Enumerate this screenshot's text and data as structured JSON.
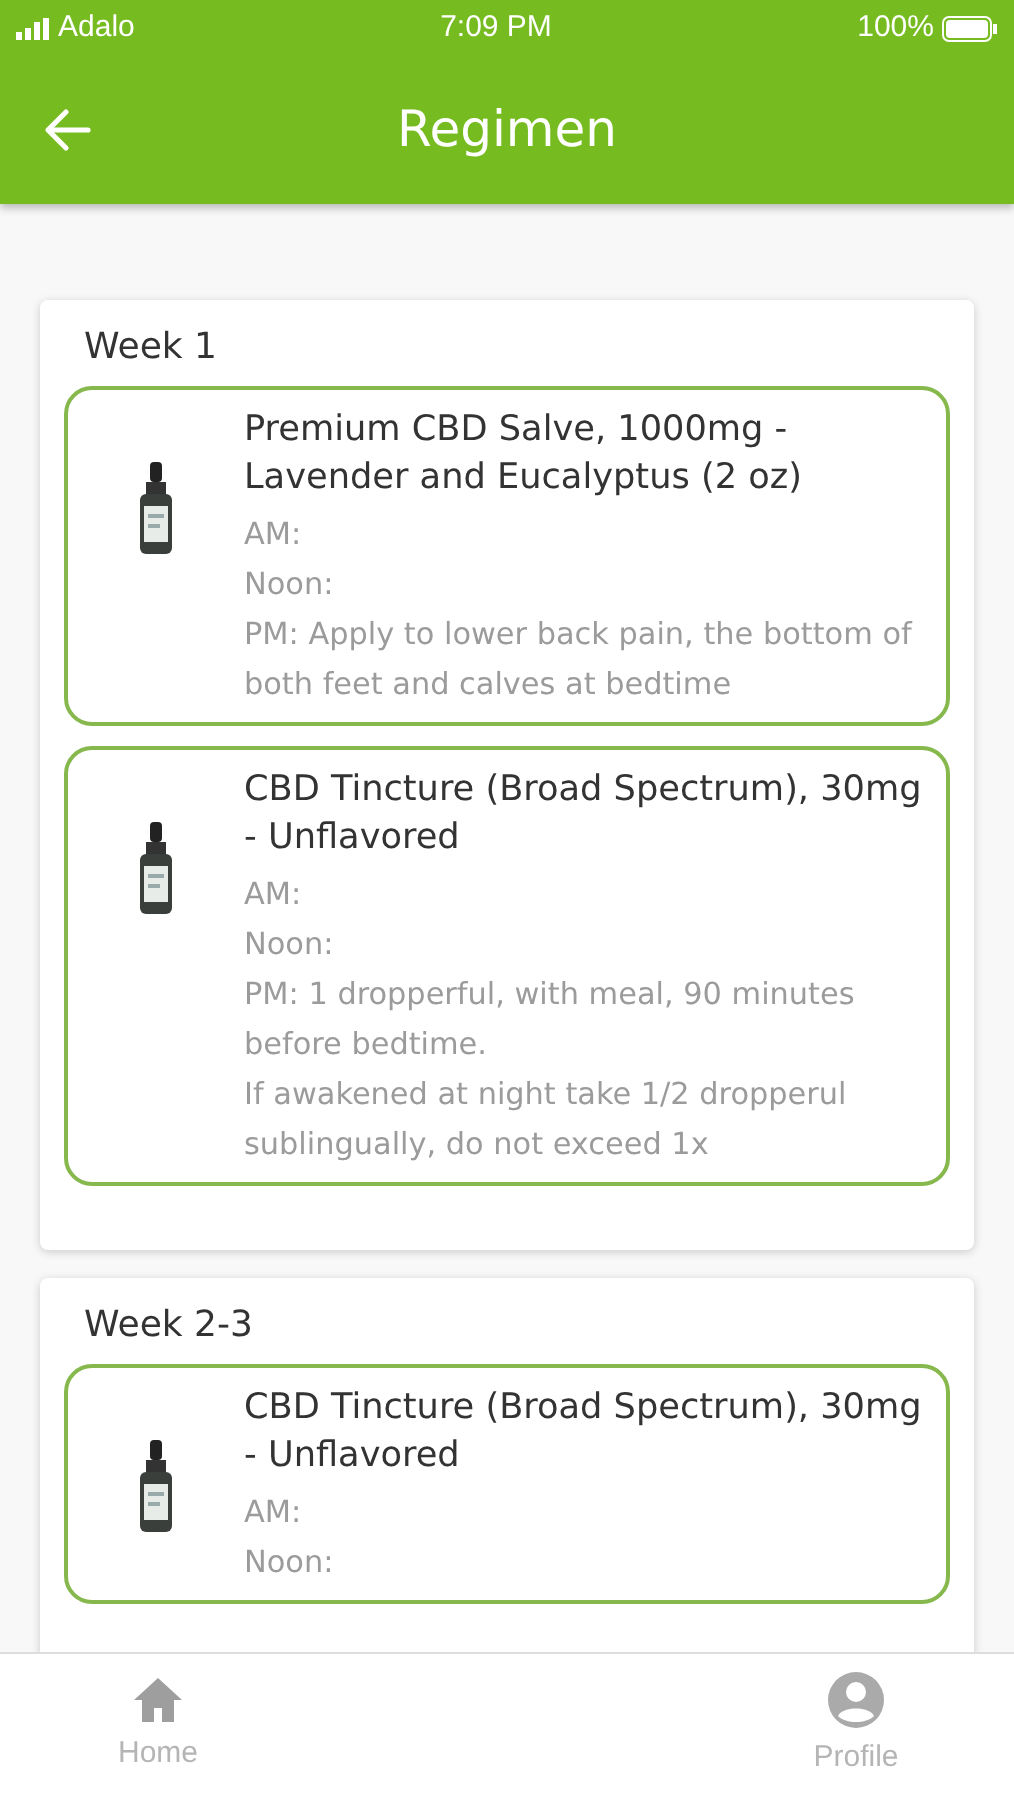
{
  "status_bar": {
    "carrier": "Adalo",
    "time": "7:09 PM",
    "battery": "100%"
  },
  "header": {
    "title": "Regimen"
  },
  "weeks": [
    {
      "title": "Week 1",
      "items": [
        {
          "name": "Premium CBD Salve, 1000mg - Lavender and Eucalyptus (2 oz)",
          "lines": [
            "AM:",
            "Noon:",
            "PM: Apply to lower back pain, the bottom of both feet and calves at bedtime"
          ]
        },
        {
          "name": "CBD Tincture (Broad Spectrum), 30mg - Unflavored",
          "lines": [
            "AM:",
            "Noon:",
            "PM: 1 dropperful, with meal, 90 minutes before bedtime.",
            "If awakened at night take 1/2 dropperul sublingually, do not exceed 1x"
          ]
        }
      ]
    },
    {
      "title": "Week 2-3",
      "items": [
        {
          "name": "CBD Tincture (Broad Spectrum), 30mg - Unflavored",
          "lines": [
            "AM:",
            "Noon:"
          ]
        }
      ]
    }
  ],
  "nav": [
    {
      "label": "Home",
      "kind": "home"
    },
    {
      "label": "Profile",
      "kind": "profile"
    }
  ]
}
